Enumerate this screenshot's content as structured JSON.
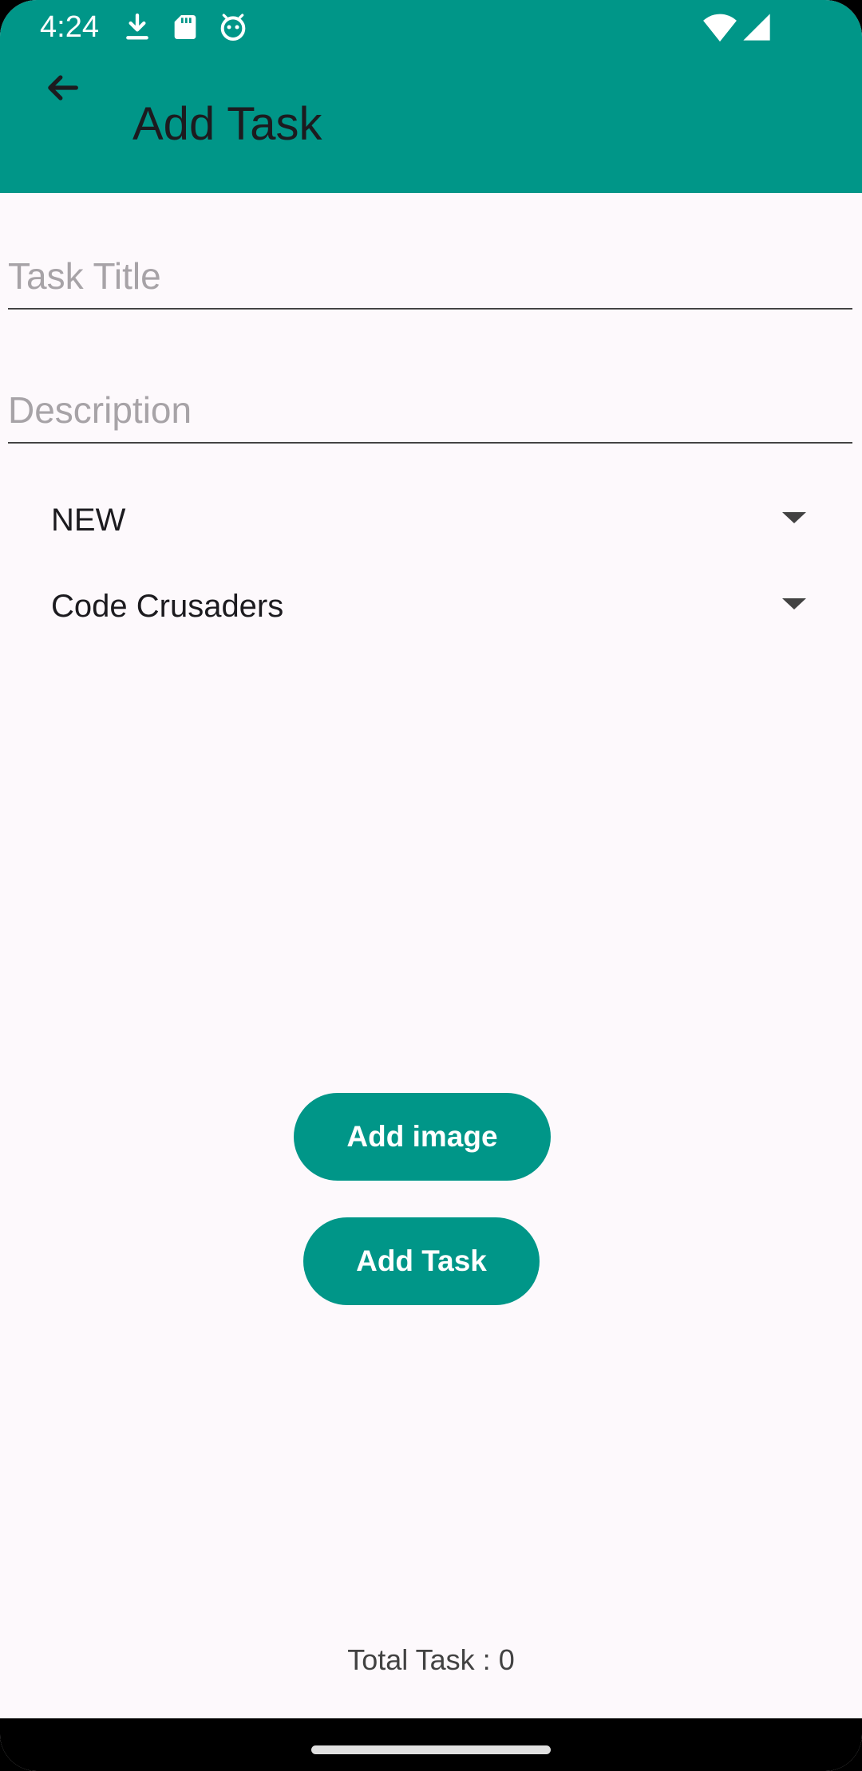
{
  "status_bar": {
    "time": "4:24",
    "icons": [
      "download-icon",
      "sd-card-icon",
      "android-debug-icon",
      "wifi-icon",
      "cellular-icon"
    ]
  },
  "app_bar": {
    "title": "Add Task",
    "back_icon": "arrow-back-icon",
    "background": "#009688"
  },
  "form": {
    "title_placeholder": "Task Title",
    "title_value": "",
    "description_placeholder": "Description",
    "description_value": "",
    "status_selected": "NEW",
    "team_selected": "Code Crusaders"
  },
  "buttons": {
    "add_image": "Add image",
    "add_task": "Add Task"
  },
  "footer": {
    "total_task": "Total Task : 0"
  },
  "colors": {
    "accent": "#009688",
    "background": "#FDF9FC",
    "text": "#1C1B1F"
  }
}
